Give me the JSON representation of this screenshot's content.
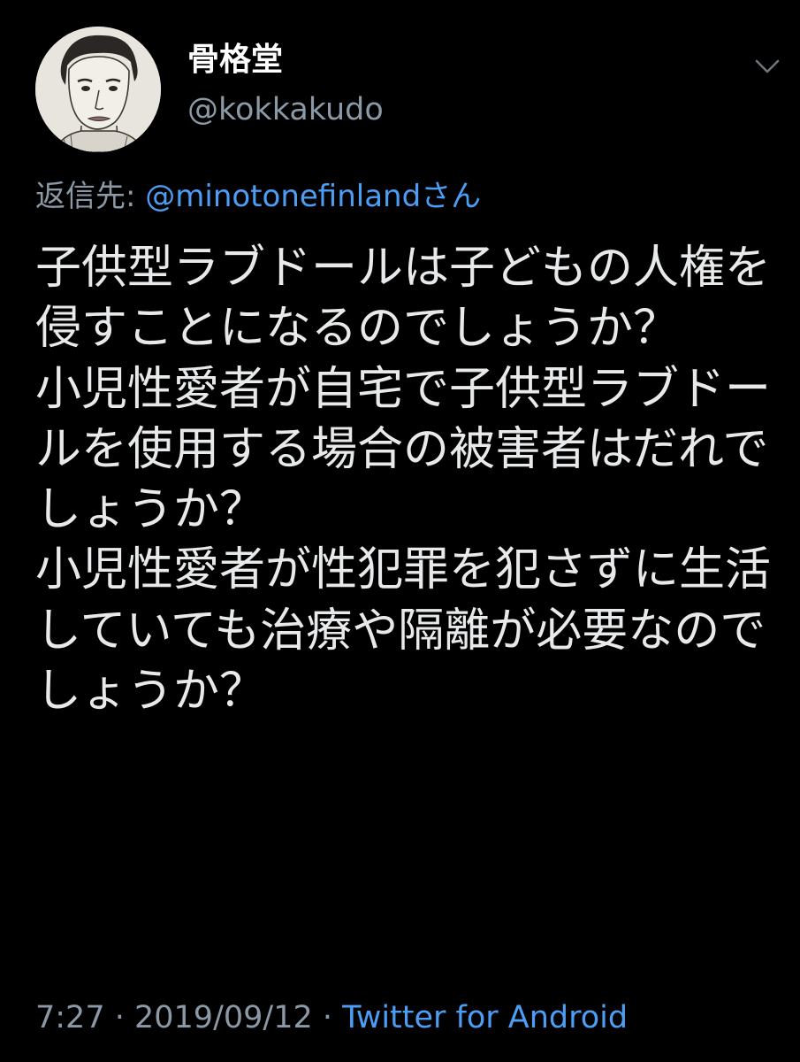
{
  "user": {
    "display_name": "骨格堂",
    "handle": "@kokkakudo",
    "avatar_icon": "portrait-sketch-icon"
  },
  "menu": {
    "icon": "chevron-down-icon"
  },
  "reply": {
    "prefix": "返信先: ",
    "target": "@minotonefinlandさん"
  },
  "tweet": {
    "text": "子供型ラブドールは子どもの人権を侵すことになるのでしょうか？\n小児性愛者が自宅で子供型ラブドールを使用する場合の被害者はだれでしょうか？\n小児性愛者が性犯罪を犯さずに生活していても治療や隔離が必要なのでしょうか？"
  },
  "meta": {
    "time": "7:27",
    "sep1": " · ",
    "date": "2019/09/12",
    "sep2": " · ",
    "source": "Twitter for Android"
  },
  "colors": {
    "background": "#000000",
    "text": "#e7e9ea",
    "secondary": "#8b98a5",
    "link": "#4c9df4"
  }
}
